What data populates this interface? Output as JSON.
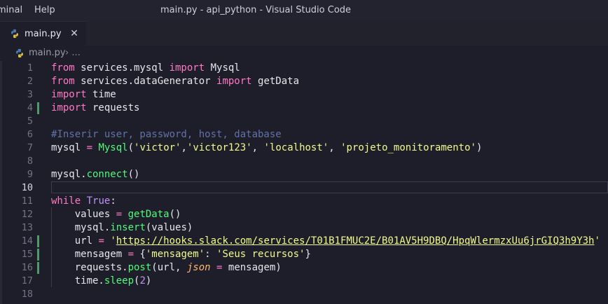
{
  "titlebar": {
    "menu_terminal": "minal",
    "menu_help": "Help",
    "window_title": "main.py - api_python - Visual Studio Code"
  },
  "tab": {
    "label": "main.py",
    "close_glyph": "✕"
  },
  "breadcrumb": {
    "file": "main.py",
    "separator": "› ..."
  },
  "editor": {
    "active_line": 10,
    "line_numbers": [
      "1",
      "2",
      "3",
      "4",
      "5",
      "6",
      "7",
      "8",
      "9",
      "10",
      "11",
      "12",
      "13",
      "14",
      "15",
      "16",
      "17",
      "18"
    ],
    "modified_lines": [
      4,
      14,
      15,
      16
    ],
    "tokens": {
      "l1": [
        "from",
        " services.mysql ",
        "import",
        " Mysql"
      ],
      "l2": [
        "from",
        " services.dataGenerator ",
        "import",
        " getData"
      ],
      "l3": [
        "import",
        " time"
      ],
      "l4": [
        "import",
        " requests"
      ],
      "l6": [
        "#Inserir user, password, host, database"
      ],
      "l7": [
        "mysql ",
        "=",
        " ",
        "Mysql",
        "(",
        "'victor'",
        ",",
        "'victor123'",
        ", ",
        "'localhost'",
        ", ",
        "'projeto_monitoramento'",
        ")"
      ],
      "l9": [
        "mysql.",
        "connect",
        "()"
      ],
      "l11": [
        "while",
        " ",
        "True",
        ":"
      ],
      "l12": [
        "    values ",
        "=",
        " ",
        "getData",
        "()"
      ],
      "l13": [
        "    mysql.",
        "insert",
        "(values)"
      ],
      "l14": [
        "    url ",
        "=",
        " ",
        "'",
        "https://hooks.slack.com/services/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",
        "'"
      ],
      "l15": [
        "    mensagem ",
        "=",
        " {",
        "'mensagem'",
        ": ",
        "'Seus recursos'",
        "}"
      ],
      "l16": [
        "    requests.",
        "post",
        "(url, ",
        "json",
        " ",
        "=",
        " mensagem)"
      ],
      "l17": [
        "    time.",
        "sleep",
        "(",
        "2",
        ")"
      ]
    }
  },
  "colors": {
    "keyword": "#ff79c6",
    "function": "#50fa7b",
    "string": "#f1fa8c",
    "comment": "#6272a4",
    "number": "#bd93f9",
    "background": "#1e1e2a"
  },
  "icons": {
    "tab_file": "python-icon",
    "breadcrumb_file": "python-icon"
  }
}
